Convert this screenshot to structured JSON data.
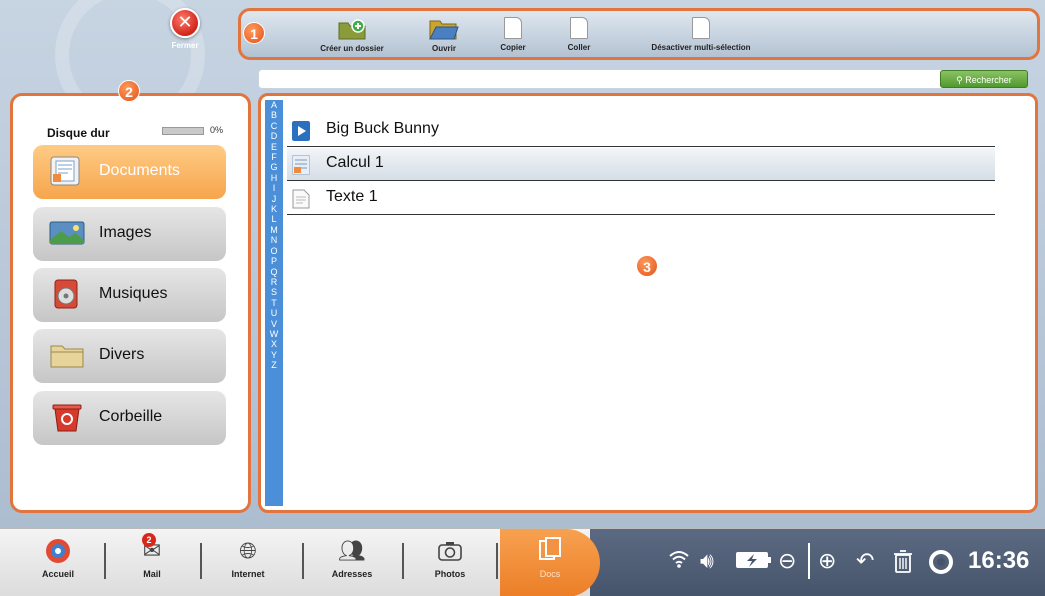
{
  "close": {
    "label": "Fermer"
  },
  "badges": {
    "toolbar": "1",
    "sidebar": "2",
    "main": "3"
  },
  "toolbar": {
    "create_folder": "Créer un dossier",
    "open": "Ouvrir",
    "copy": "Copier",
    "paste": "Coller",
    "multi_select": "Désactiver multi-sélection"
  },
  "search": {
    "value": "",
    "button_label": "Rechercher"
  },
  "sidebar": {
    "disk_label": "Disque dur",
    "disk_usage_percent_value": 0,
    "disk_usage_text": "0%",
    "items": [
      {
        "label": "Documents",
        "icon": "documents-icon",
        "active": true
      },
      {
        "label": "Images",
        "icon": "images-icon",
        "active": false
      },
      {
        "label": "Musiques",
        "icon": "music-icon",
        "active": false
      },
      {
        "label": "Divers",
        "icon": "folder-icon",
        "active": false
      },
      {
        "label": "Corbeille",
        "icon": "trash-icon",
        "active": false
      }
    ]
  },
  "alphabet": [
    "A",
    "B",
    "C",
    "D",
    "E",
    "F",
    "G",
    "H",
    "I",
    "J",
    "K",
    "L",
    "M",
    "N",
    "O",
    "P",
    "Q",
    "R",
    "S",
    "T",
    "U",
    "V",
    "W",
    "X",
    "Y",
    "Z"
  ],
  "files": [
    {
      "name": "Big Buck Bunny",
      "icon": "video-file-icon",
      "selected": false
    },
    {
      "name": "Calcul 1",
      "icon": "spreadsheet-file-icon",
      "selected": true
    },
    {
      "name": "Texte 1",
      "icon": "text-file-icon",
      "selected": false
    }
  ],
  "taskbar": {
    "home": "Accueil",
    "mail": "Mail",
    "mail_count": "2",
    "internet": "Internet",
    "contacts": "Adresses",
    "photos": "Photos",
    "docs": "Docs"
  },
  "system": {
    "time": "16:36"
  },
  "colors": {
    "accent_orange": "#e2743e",
    "alphabet_blue": "#4a8fd8",
    "search_green": "#5fa83a"
  }
}
